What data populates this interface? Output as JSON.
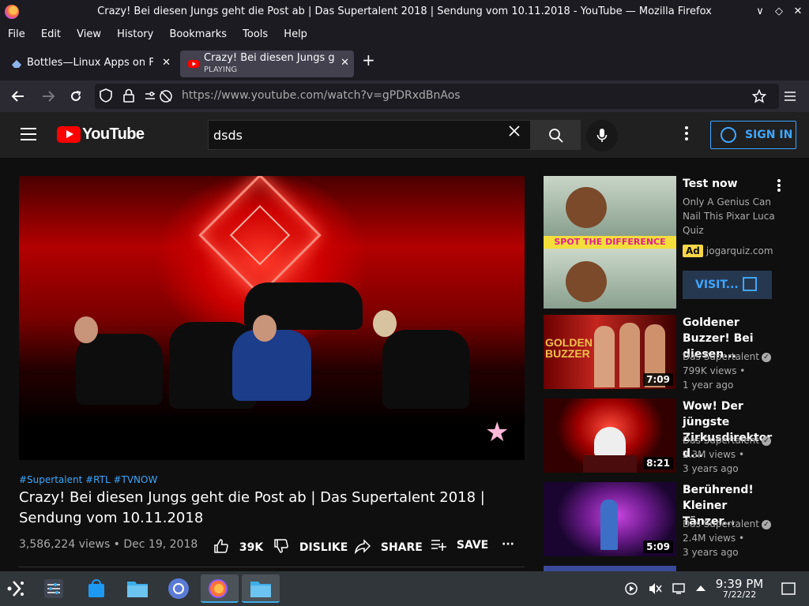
{
  "window": {
    "title": "Crazy! Bei diesen Jungs geht die Post ab | Das Supertalent 2018 | Sendung vom 10.11.2018 - YouTube — Mozilla Firefox",
    "btn_min": "∨",
    "btn_max": "◇",
    "btn_close": "✕"
  },
  "menu": [
    "File",
    "Edit",
    "View",
    "History",
    "Bookmarks",
    "Tools",
    "Help"
  ],
  "tabs": [
    {
      "title": "Bottles—Linux Apps on Flathub",
      "close": "✕"
    },
    {
      "title": "Crazy! Bei diesen Jungs geht die Post ab",
      "sub": "PLAYING",
      "close": "✕"
    }
  ],
  "newtab": "+",
  "nav": {
    "url_host": "https://www.youtube.com",
    "url_path": "/watch?v=gPDRxdBnAos",
    "back_icon": "back-arrow-icon",
    "forward_icon": "forward-arrow-icon",
    "reload_icon": "reload-icon"
  },
  "youtube": {
    "logo": "YouTube",
    "search_value": "dsds",
    "sign_in": "SIGN IN",
    "video": {
      "hashtags": "#Supertalent #RTL #TVNOW",
      "title": "Crazy! Bei diesen Jungs geht die Post ab | Das Supertalent 2018 | Sendung vom 10.11.2018",
      "views_date": "3,586,224 views • Dec 19, 2018",
      "likes": "39K",
      "dislike": "DISLIKE",
      "share": "SHARE",
      "save": "SAVE",
      "more": "···"
    },
    "ad": {
      "title": "Test now",
      "desc": "Only A Genius Can Nail This Pixar Luca Quiz",
      "badge": "Ad",
      "domain": "jogarquiz.com",
      "visit": "VISIT...",
      "thumb_text": "SPOT THE DIFFERENCE"
    },
    "related": [
      {
        "title": "Goldener Buzzer! Bei diesen...",
        "channel": "Das Supertalent",
        "views": "799K views •",
        "age": "1 year ago",
        "duration": "7:09",
        "thumb_text": "GOLDEN BUZZER"
      },
      {
        "title": "Wow! Der jüngste Zirkusdirektor d...",
        "channel": "Das Supertalent",
        "views": "2.3M views •",
        "age": "3 years ago",
        "duration": "8:21"
      },
      {
        "title": "Berührend! Kleiner Tänzer...",
        "channel": "Das Supertalent",
        "views": "2.4M views •",
        "age": "3 years ago",
        "duration": "5:09"
      }
    ]
  },
  "taskbar": {
    "time": "9:39 PM",
    "date": "7/22/22"
  }
}
